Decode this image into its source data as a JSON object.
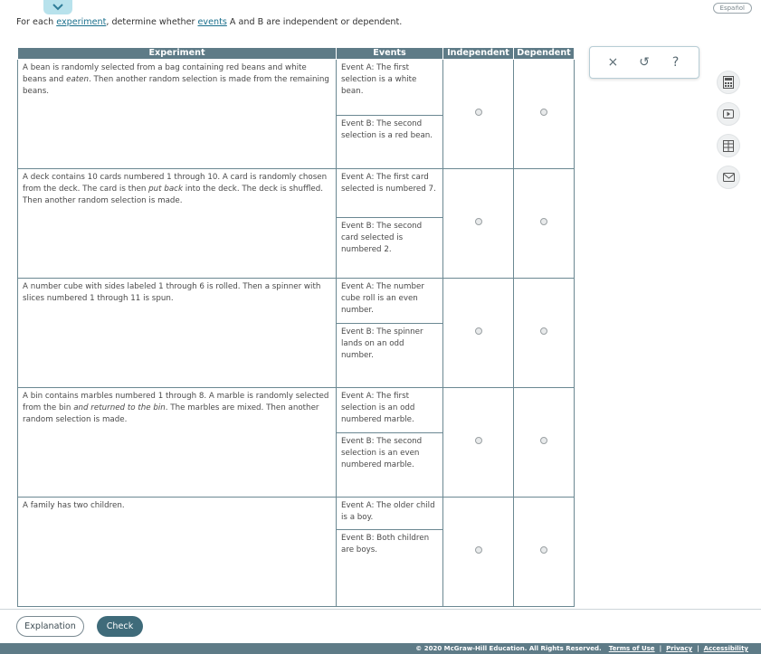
{
  "header": {
    "language_label": "Español"
  },
  "instruction": {
    "prefix": "For each ",
    "link1": "experiment",
    "middle": ", determine whether ",
    "link2": "events",
    "suffix": " A and B are independent or dependent."
  },
  "table": {
    "headers": [
      "Experiment",
      "Events",
      "Independent",
      "Dependent"
    ],
    "rows": [
      {
        "exp_parts": [
          "A bean is randomly selected from a bag containing red beans and white beans and ",
          "eaten",
          ". Then another random selection is made from the remaining beans."
        ],
        "event_a": "Event A: The first selection is a white bean.",
        "event_b": "Event B: The second selection is a red bean."
      },
      {
        "exp_parts": [
          "A deck contains 10 cards numbered 1 through 10. A card is randomly chosen from the deck. The card is then ",
          "put back",
          " into the deck. The deck is shuffled. Then another random selection is made."
        ],
        "event_a": "Event A: The first card selected is numbered 7.",
        "event_b": "Event B: The second card selected is numbered 2."
      },
      {
        "exp_parts": [
          "A number cube with sides labeled 1 through 6 is rolled. Then a spinner with slices numbered 1 through 11 is spun.",
          "",
          ""
        ],
        "event_a": "Event A: The number cube roll is an even number.",
        "event_b": "Event B: The spinner lands on an odd number."
      },
      {
        "exp_parts": [
          "A bin contains marbles numbered 1 through 8. A marble is randomly selected from the bin ",
          "and returned to the bin",
          ". The marbles are mixed. Then another random selection is made."
        ],
        "event_a": "Event A: The first selection is an odd numbered marble.",
        "event_b": "Event B: The second selection is an even numbered marble."
      },
      {
        "exp_parts": [
          "A family has two children.",
          "",
          ""
        ],
        "event_a": "Event A: The older child is a boy.",
        "event_b": "Event B: Both children are boys."
      }
    ]
  },
  "toolbar": {
    "clear_symbol": "×",
    "undo_symbol": "↺",
    "help_symbol": "?"
  },
  "buttons": {
    "explanation": "Explanation",
    "check": "Check"
  },
  "footer": {
    "copyright": "© 2020 McGraw-Hill Education. All Rights Reserved.",
    "terms": "Terms of Use",
    "privacy": "Privacy",
    "accessibility": "Accessibility",
    "separator": "|"
  },
  "icons": [
    "chevron-down-icon",
    "calculator-icon",
    "video-icon",
    "data-table-icon",
    "mail-icon"
  ],
  "colors": {
    "header_bg": "#5e7b87",
    "check_bg": "#3f6b7a",
    "link": "#1a6f8c"
  }
}
